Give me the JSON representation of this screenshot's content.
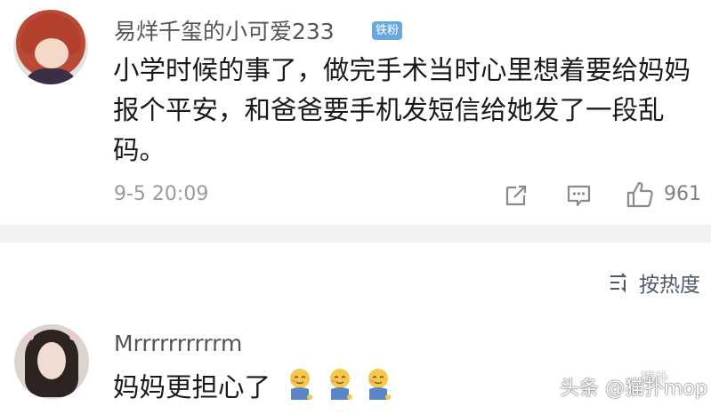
{
  "comment1": {
    "username": "易烊千玺的小可爱233",
    "badge": "铁粉",
    "content": "小学时候的事了，做完手术当时心里想着要给妈妈报个平安，和爸爸要手机发短信给她发了一段乱码。",
    "date": "9-5 20:09",
    "like_count": "961"
  },
  "sort": {
    "label": "按热度"
  },
  "comment2": {
    "username": "Mrrrrrrrrrrm",
    "content": "妈妈更担心了"
  },
  "watermark": {
    "text": "头条 @猫扑mop",
    "logo_text": "猫扑"
  },
  "icons": {
    "share": "share-icon",
    "comment": "comment-icon",
    "like": "thumbs-up-icon",
    "sort": "sort-icon",
    "emoji": "shy-smile-emoji"
  },
  "colors": {
    "badge": "#67a8e3",
    "divider": "#f2f2f2",
    "muted_text": "#9a9a9a"
  }
}
